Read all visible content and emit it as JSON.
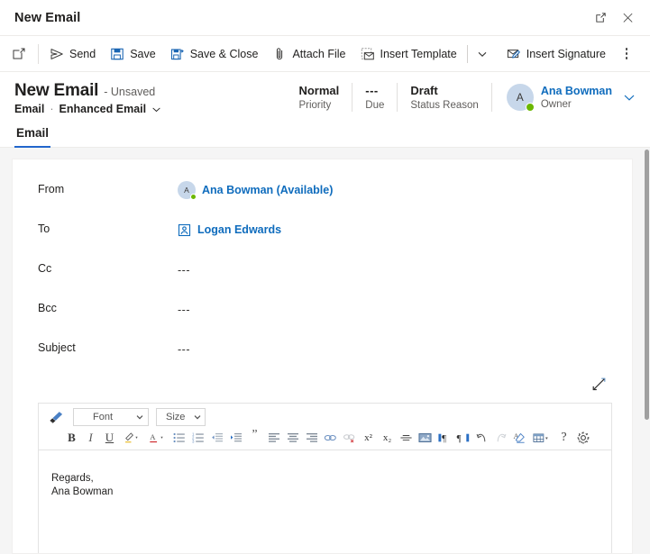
{
  "window": {
    "title": "New Email",
    "popout_icon": "pop-out-icon",
    "close_icon": "close-icon"
  },
  "commandbar": {
    "new_icon": "new-record-icon",
    "items": [
      {
        "label": "Send",
        "icon": "send-icon"
      },
      {
        "label": "Save",
        "icon": "save-icon"
      },
      {
        "label": "Save & Close",
        "icon": "save-and-close-icon"
      },
      {
        "label": "Attach File",
        "icon": "paperclip-icon"
      },
      {
        "label": "Insert Template",
        "icon": "insert-template-icon"
      },
      {
        "label": "Insert Signature",
        "icon": "insert-signature-icon"
      }
    ],
    "overflow_label": "More commands"
  },
  "record_header": {
    "title": "New Email",
    "unsaved": "- Unsaved",
    "entity": "Email",
    "separator": "·",
    "form_name": "Enhanced Email",
    "stats": [
      {
        "value": "Normal",
        "label": "Priority"
      },
      {
        "value": "---",
        "label": "Due"
      },
      {
        "value": "Draft",
        "label": "Status Reason"
      }
    ],
    "owner": {
      "initial": "A",
      "name": "Ana Bowman",
      "role": "Owner"
    }
  },
  "tabs": [
    {
      "label": "Email",
      "active": true
    }
  ],
  "form": {
    "fields": [
      {
        "label": "From",
        "type": "person",
        "initial": "A",
        "value": "Ana Bowman (Available)"
      },
      {
        "label": "To",
        "type": "contact",
        "value": "Logan Edwards"
      },
      {
        "label": "Cc",
        "type": "empty",
        "value": "---"
      },
      {
        "label": "Bcc",
        "type": "empty",
        "value": "---"
      },
      {
        "label": "Subject",
        "type": "empty",
        "value": "---"
      }
    ],
    "expand_icon": "expand-diagonal-icon"
  },
  "editor": {
    "format_painter_icon": "format-painter-icon",
    "font": {
      "value": "Font",
      "caret": "▾"
    },
    "size": {
      "value": "Size",
      "caret": "▾"
    },
    "buttons": [
      {
        "name": "bold",
        "glyph": "B"
      },
      {
        "name": "italic",
        "glyph": "I"
      },
      {
        "name": "underline",
        "glyph": "U"
      },
      {
        "name": "highlight-color",
        "glyph": ""
      },
      {
        "name": "font-color",
        "glyph": "A"
      },
      {
        "name": "bulleted-list",
        "glyph": ""
      },
      {
        "name": "numbered-list",
        "glyph": ""
      },
      {
        "name": "decrease-indent",
        "glyph": ""
      },
      {
        "name": "increase-indent",
        "glyph": ""
      },
      {
        "name": "blockquote",
        "glyph": "”"
      },
      {
        "name": "align-left",
        "glyph": ""
      },
      {
        "name": "align-center",
        "glyph": ""
      },
      {
        "name": "align-right",
        "glyph": ""
      },
      {
        "name": "insert-link",
        "glyph": ""
      },
      {
        "name": "remove-link",
        "glyph": ""
      },
      {
        "name": "superscript",
        "glyph": "x²"
      },
      {
        "name": "subscript",
        "glyph": "x₂"
      },
      {
        "name": "strikethrough",
        "glyph": ""
      },
      {
        "name": "insert-image",
        "glyph": ""
      },
      {
        "name": "ltr-direction",
        "glyph": ""
      },
      {
        "name": "rtl-direction",
        "glyph": ""
      },
      {
        "name": "undo",
        "glyph": "↺"
      },
      {
        "name": "redo",
        "glyph": "↻"
      },
      {
        "name": "clear-formatting",
        "glyph": ""
      },
      {
        "name": "insert-table",
        "glyph": ""
      },
      {
        "name": "help",
        "glyph": "?"
      },
      {
        "name": "editor-settings",
        "glyph": ""
      }
    ],
    "body_lines": [
      "Regards,",
      "Ana Bowman"
    ]
  },
  "colors": {
    "accent": "#0f6cbd",
    "tab_underline": "#2266cc",
    "presence_available": "#6bb700",
    "canvas_bg": "#f5f5f5",
    "avatar_bg": "#c7d7ea"
  }
}
